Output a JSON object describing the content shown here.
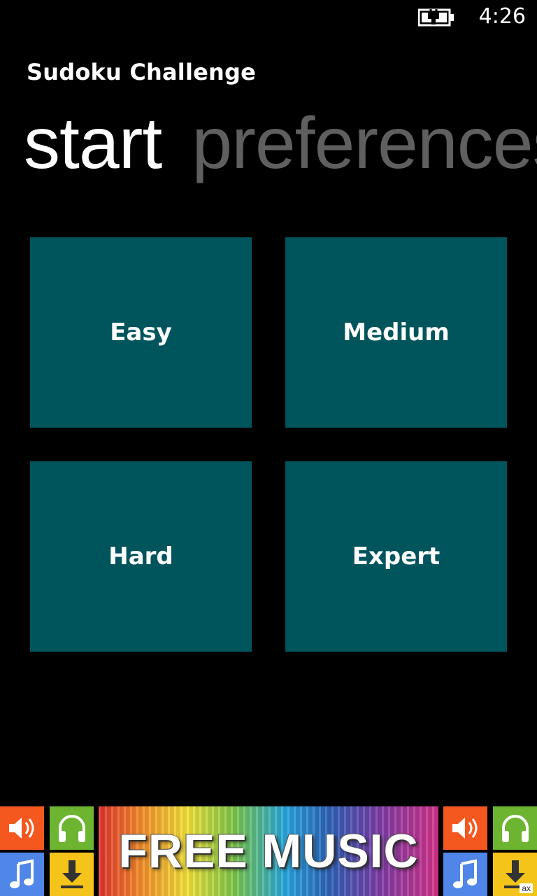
{
  "status": {
    "time": "4:26",
    "battery_icon": "battery-charging-icon"
  },
  "app": {
    "title": "Sudoku Challenge"
  },
  "pivot": {
    "items": [
      {
        "label": "start",
        "active": true
      },
      {
        "label": "preferences",
        "active": false
      }
    ]
  },
  "difficulty": {
    "tiles": [
      {
        "label": "Easy"
      },
      {
        "label": "Medium"
      },
      {
        "label": "Hard"
      },
      {
        "label": "Expert"
      }
    ],
    "tile_color": "#00545c"
  },
  "ad": {
    "text": "FREE MUSIC",
    "badge": "ax",
    "icons": [
      "speaker-icon",
      "headphones-icon",
      "music-note-icon",
      "download-icon"
    ],
    "colors": {
      "orange": "#f4581f",
      "green": "#6db430",
      "blue": "#4f86e8",
      "yellow": "#f5c41b"
    }
  }
}
